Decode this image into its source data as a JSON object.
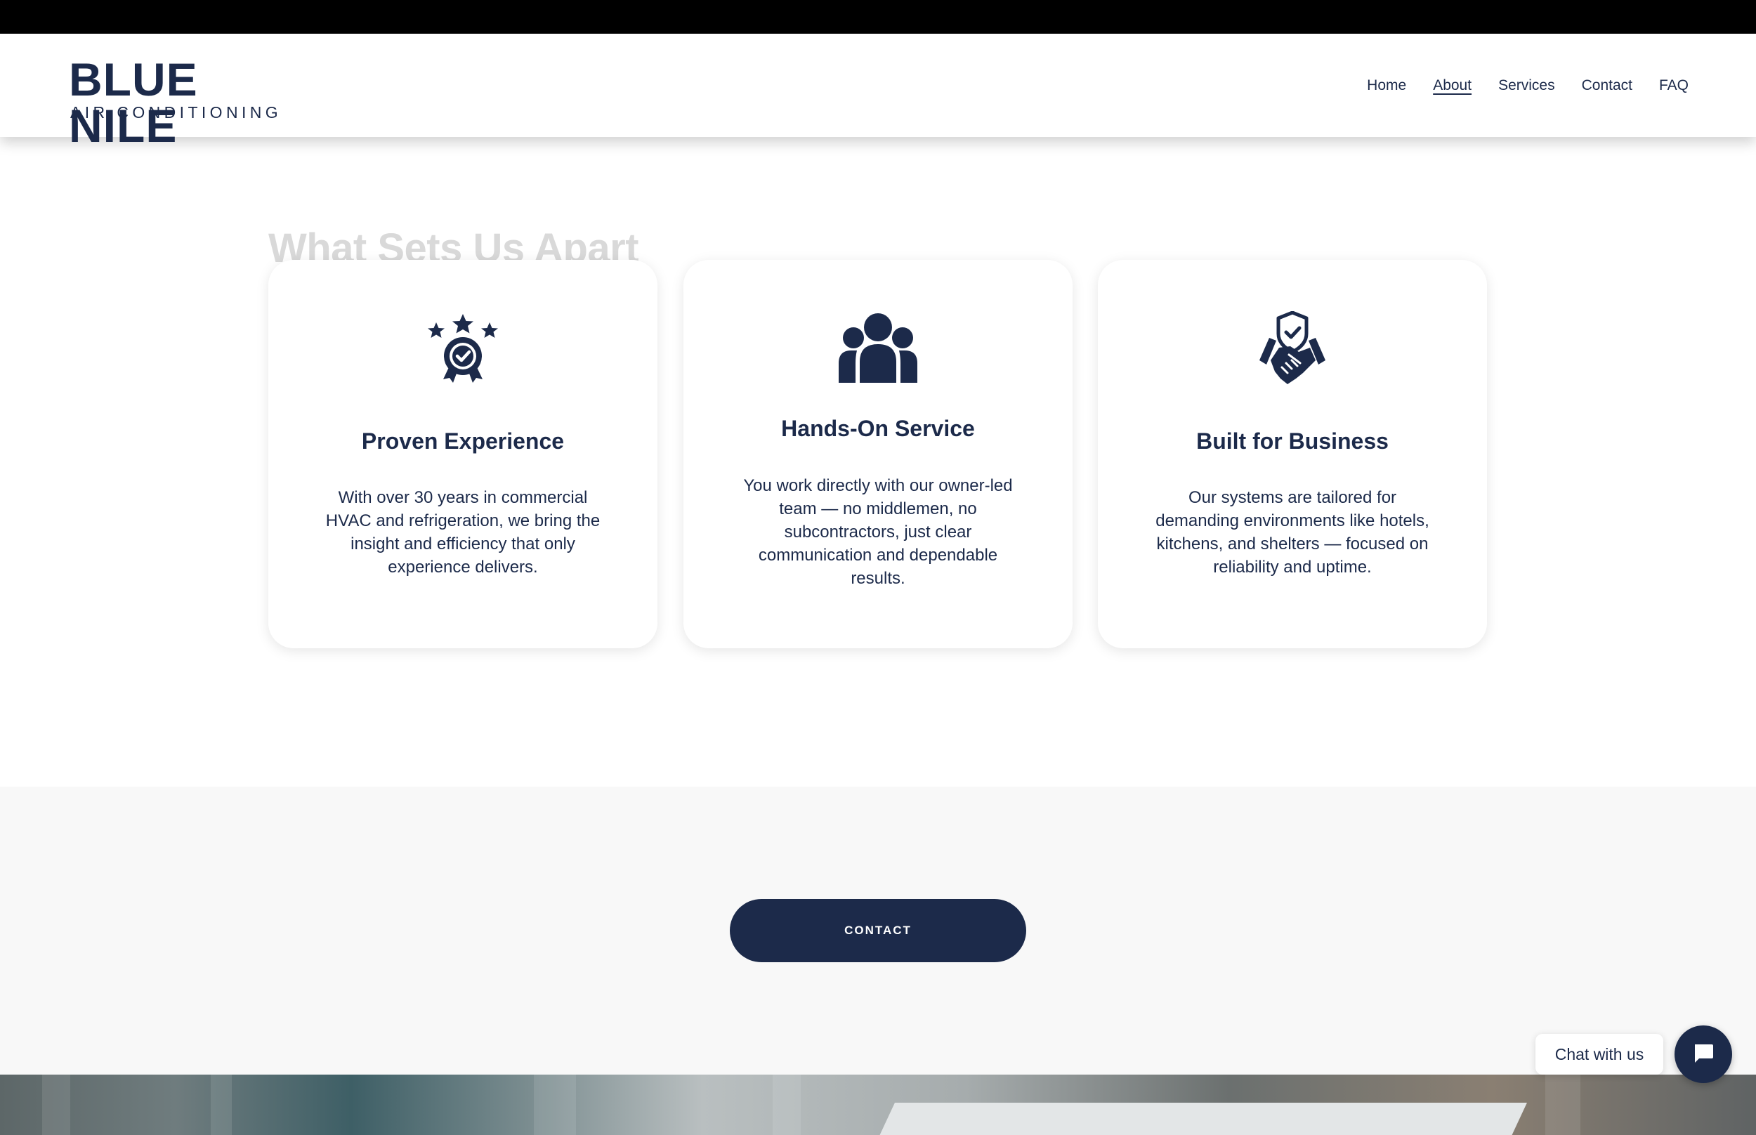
{
  "header": {
    "logo_top": "BLUE NILE",
    "logo_bottom": "AIR CONDITIONING",
    "nav": [
      "Home",
      "About",
      "Services",
      "Contact",
      "FAQ"
    ],
    "active_nav": "About"
  },
  "section": {
    "title": "What Sets Us Apart",
    "cards": [
      {
        "icon": "award-stars-icon",
        "title": "Proven Experience",
        "description": "With over 30 years in commercial HVAC and refrigeration, we bring the insight and efficiency that only experience delivers."
      },
      {
        "icon": "team-icon",
        "title": "Hands-On Service",
        "description": "You work directly with our owner-led team — no middlemen, no subcontractors, just clear communication and dependable results."
      },
      {
        "icon": "handshake-shield-icon",
        "title": "Built for Business",
        "description": "Our systems are tailored for demanding environments like hotels, kitchens, and shelters — focused on reliability and uptime."
      }
    ]
  },
  "cta": {
    "contact_label": "CONTACT"
  },
  "chat": {
    "label": "Chat with us",
    "icon": "chat-bubble-icon"
  },
  "colors": {
    "brand": "#1c2a4a",
    "title_faded": "#d9d9d9",
    "band": "#f8f8f8"
  }
}
